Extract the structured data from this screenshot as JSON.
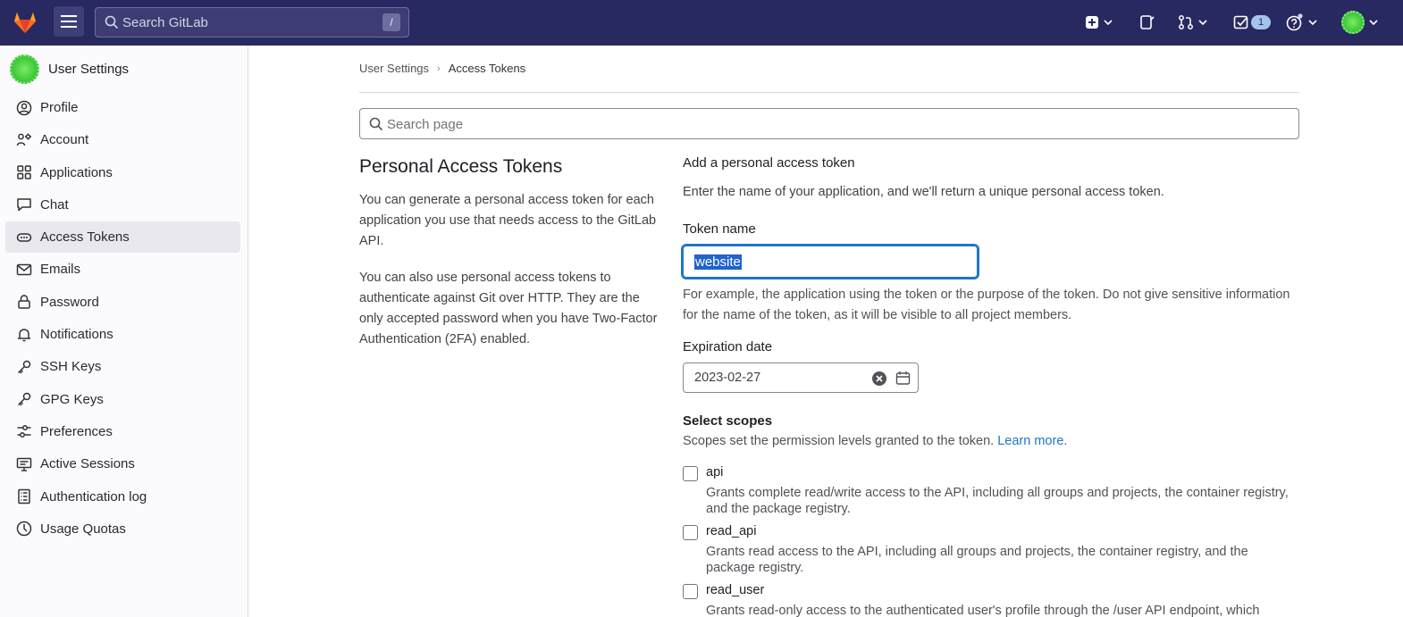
{
  "topbar": {
    "search_placeholder": "Search GitLab",
    "search_shortcut": "/",
    "todo_count": "1"
  },
  "sidebar": {
    "title": "User Settings",
    "items": [
      {
        "label": "Profile",
        "icon": "profile-icon",
        "active": false
      },
      {
        "label": "Account",
        "icon": "account-icon",
        "active": false
      },
      {
        "label": "Applications",
        "icon": "applications-icon",
        "active": false
      },
      {
        "label": "Chat",
        "icon": "chat-icon",
        "active": false
      },
      {
        "label": "Access Tokens",
        "icon": "token-icon",
        "active": true
      },
      {
        "label": "Emails",
        "icon": "mail-icon",
        "active": false
      },
      {
        "label": "Password",
        "icon": "lock-icon",
        "active": false
      },
      {
        "label": "Notifications",
        "icon": "bell-icon",
        "active": false
      },
      {
        "label": "SSH Keys",
        "icon": "key-icon",
        "active": false
      },
      {
        "label": "GPG Keys",
        "icon": "key-icon",
        "active": false
      },
      {
        "label": "Preferences",
        "icon": "preferences-icon",
        "active": false
      },
      {
        "label": "Active Sessions",
        "icon": "monitor-icon",
        "active": false
      },
      {
        "label": "Authentication log",
        "icon": "log-icon",
        "active": false
      },
      {
        "label": "Usage Quotas",
        "icon": "quota-icon",
        "active": false
      }
    ]
  },
  "breadcrumb": {
    "parent": "User Settings",
    "current": "Access Tokens"
  },
  "page_search": {
    "placeholder": "Search page"
  },
  "intro": {
    "title": "Personal Access Tokens",
    "para1": "You can generate a personal access token for each application you use that needs access to the GitLab API.",
    "para2": "You can also use personal access tokens to authenticate against Git over HTTP. They are the only accepted password when you have Two-Factor Authentication (2FA) enabled."
  },
  "form": {
    "heading": "Add a personal access token",
    "description": "Enter the name of your application, and we'll return a unique personal access token.",
    "token_name_label": "Token name",
    "token_name_value": "website",
    "token_name_help": "For example, the application using the token or the purpose of the token. Do not give sensitive information for the name of the token, as it will be visible to all project members.",
    "expiration_label": "Expiration date",
    "expiration_value": "2023-02-27",
    "scopes_heading": "Select scopes",
    "scopes_description": "Scopes set the permission levels granted to the token.",
    "learn_more": "Learn more.",
    "scopes": [
      {
        "name": "api",
        "description": "Grants complete read/write access to the API, including all groups and projects, the container registry, and the package registry."
      },
      {
        "name": "read_api",
        "description": "Grants read access to the API, including all groups and projects, the container registry, and the package registry."
      },
      {
        "name": "read_user",
        "description": "Grants read-only access to the authenticated user's profile through the /user API endpoint, which"
      }
    ]
  },
  "colors": {
    "navbar": "#292961",
    "link": "#1f75cb",
    "active_item": "#e9e8ee"
  }
}
